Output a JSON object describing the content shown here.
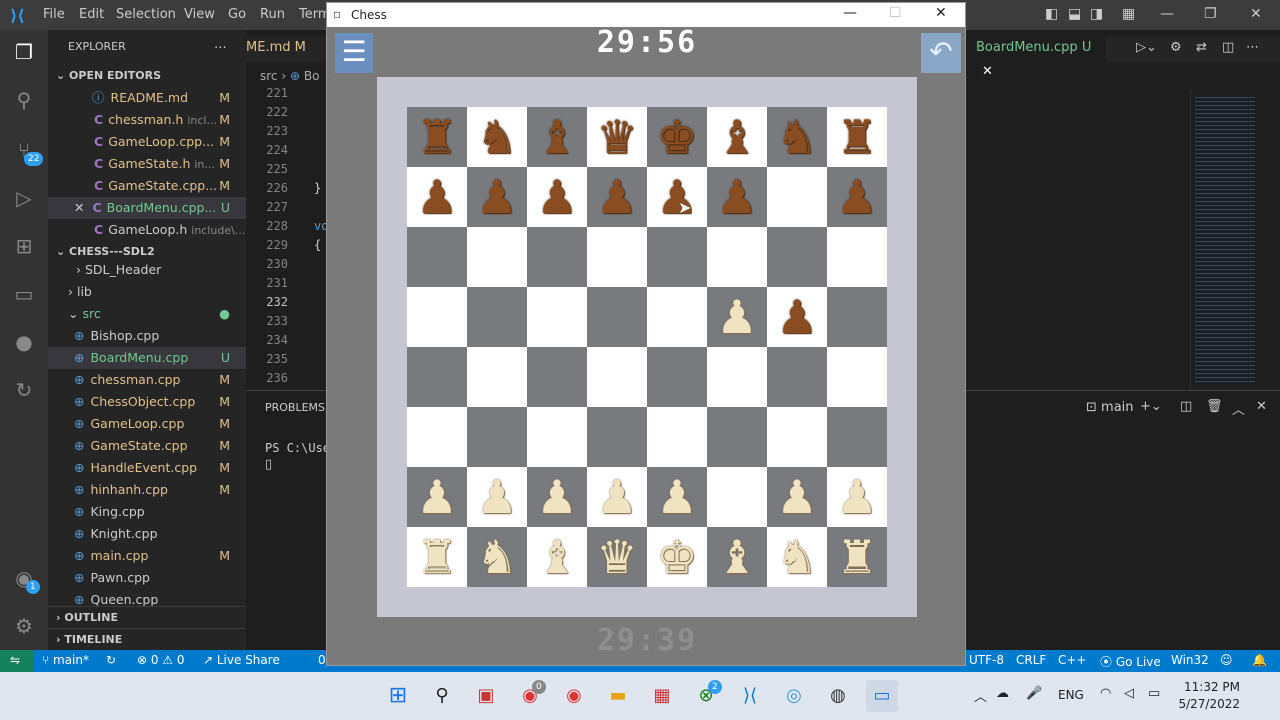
{
  "vscode": {
    "menu": [
      "File",
      "Edit",
      "Selection",
      "View",
      "Go",
      "Run",
      "Term"
    ],
    "explorer_title": "EXPLORER",
    "open_editors_label": "OPEN EDITORS",
    "open_editors": [
      {
        "name": "README.md",
        "hint": "",
        "status": "M"
      },
      {
        "name": "chessman.h",
        "hint": "incl...",
        "status": "M"
      },
      {
        "name": "GameLoop.cpp...",
        "hint": "",
        "status": "M"
      },
      {
        "name": "GameState.h",
        "hint": "in...",
        "status": "M"
      },
      {
        "name": "GameState.cpp...",
        "hint": "",
        "status": "M"
      },
      {
        "name": "BoardMenu.cpp...",
        "hint": "",
        "status": "U"
      },
      {
        "name": "GameLoop.h",
        "hint": "include\\...",
        "status": ""
      }
    ],
    "project_label": "CHESS---SDL2",
    "folders": [
      "SDL_Header",
      "lib",
      "src"
    ],
    "src_files": [
      {
        "name": "Bishop.cpp",
        "status": ""
      },
      {
        "name": "BoardMenu.cpp",
        "status": "U"
      },
      {
        "name": "chessman.cpp",
        "status": "M"
      },
      {
        "name": "ChessObject.cpp",
        "status": "M"
      },
      {
        "name": "GameLoop.cpp",
        "status": "M"
      },
      {
        "name": "GameState.cpp",
        "status": "M"
      },
      {
        "name": "HandleEvent.cpp",
        "status": "M"
      },
      {
        "name": "hinhanh.cpp",
        "status": "M"
      },
      {
        "name": "King.cpp",
        "status": ""
      },
      {
        "name": "Knight.cpp",
        "status": ""
      },
      {
        "name": "main.cpp",
        "status": "M"
      },
      {
        "name": "Pawn.cpp",
        "status": ""
      },
      {
        "name": "Queen.cpp",
        "status": ""
      }
    ],
    "outline_label": "OUTLINE",
    "timeline_label": "TIMELINE",
    "tab_left": "ME.md",
    "tab_left_status": "M",
    "tab_right": "BoardMenu.cpp",
    "tab_right_status": "U",
    "breadcrumb": "src",
    "breadcrumb_2": "Bo",
    "line_numbers": [
      "221",
      "222",
      "223",
      "224",
      "225",
      "226",
      "227",
      "228",
      "229",
      "230",
      "231",
      "232",
      "233",
      "234",
      "235",
      "236"
    ],
    "code_brace_close": "}",
    "code_vo": "vo",
    "code_brace_open": "{",
    "panel_label": "PROBLEMS",
    "terminal_prompt": "PS C:\\Use",
    "terminal_shell": "main",
    "source_control_badge": "22",
    "accounts_badge": "1"
  },
  "statusbar": {
    "branch": "main*",
    "errors": "0",
    "warnings": "0",
    "live_share": "Live Share",
    "zero": "0",
    "encoding": "UTF-8",
    "eol": "CRLF",
    "language": "C++",
    "go_live": "Go Live",
    "platform": "Win32"
  },
  "chess": {
    "window_title": "Chess",
    "timer_top": "29:56",
    "timer_bottom": "29:39",
    "board": [
      [
        "bR",
        "bN",
        "bB",
        "bQ",
        "bK",
        "bB",
        "bN",
        "bR"
      ],
      [
        "bP",
        "bP",
        "bP",
        "bP",
        "bP",
        "bP",
        "",
        "bP"
      ],
      [
        "",
        "",
        "",
        "",
        "",
        "",
        "",
        ""
      ],
      [
        "",
        "",
        "",
        "",
        "",
        "wP",
        "bP",
        ""
      ],
      [
        "",
        "",
        "",
        "",
        "",
        "",
        "",
        ""
      ],
      [
        "",
        "",
        "",
        "",
        "",
        "",
        "",
        ""
      ],
      [
        "wP",
        "wP",
        "wP",
        "wP",
        "wP",
        "",
        "wP",
        "wP"
      ],
      [
        "wR",
        "wN",
        "wB",
        "wQ",
        "wK",
        "wB",
        "wN",
        "wR"
      ]
    ],
    "glyphs": {
      "K": "♚",
      "Q": "♛",
      "R": "♜",
      "B": "♝",
      "N": "♞",
      "P": "♟"
    }
  },
  "taskbar": {
    "lang": "ENG",
    "time": "11:32 PM",
    "date": "5/27/2022",
    "chrome_badge": "0",
    "xbox_badge": "2"
  }
}
